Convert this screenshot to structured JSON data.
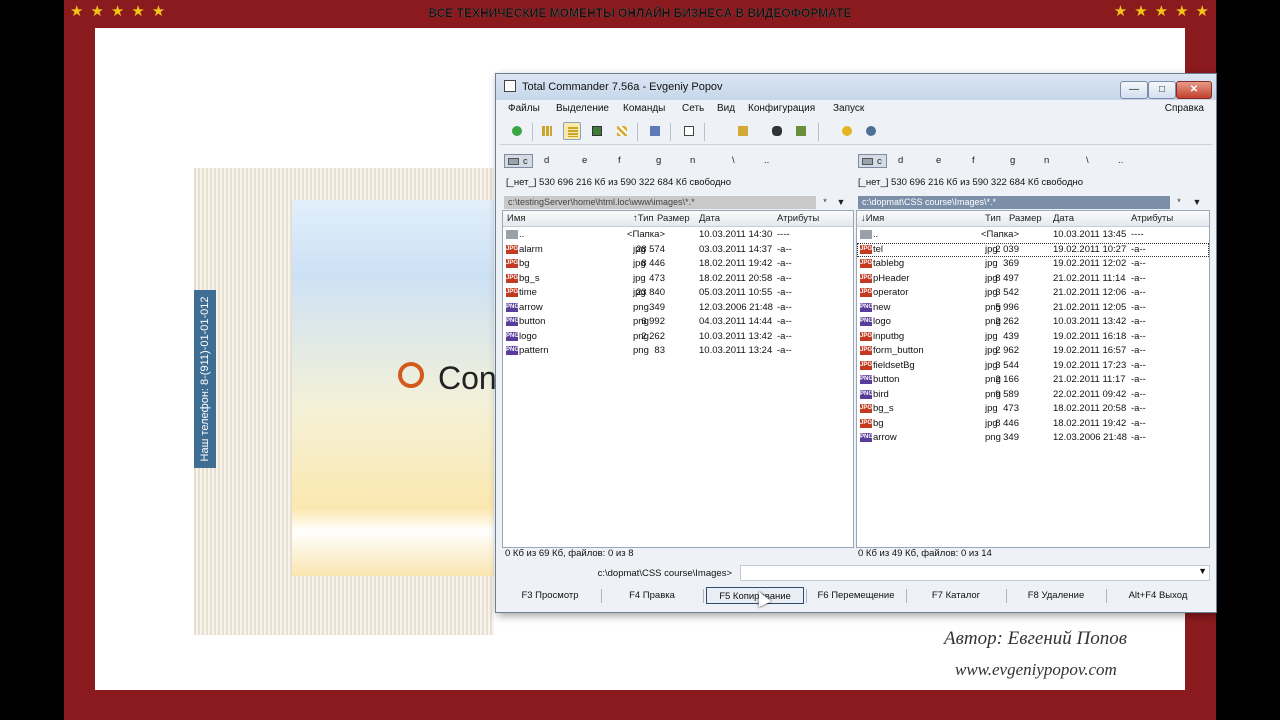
{
  "banner": "ВСЕ ТЕХНИЧЕСКИЕ МОМЕНТЫ ОНЛАЙН БИЗНЕСА В ВИДЕОФОРМАТЕ",
  "stars": "★★★★★",
  "site": {
    "phone": "Наш телефон: 8-(911)-01-01-012",
    "logo_text": "Con"
  },
  "credits": {
    "author": "Автор:  Евгений  Попов",
    "website": "www.evgeniypopov.com"
  },
  "colors": {
    "frame": "#8a1a1e",
    "star": "#f2c319",
    "tc_active_path": "#7c8fa8",
    "tc_window": "#eef1f5"
  },
  "tc": {
    "title": "Total Commander 7.56a - Evgeniy Popov",
    "window_buttons": {
      "minimize": "—",
      "maximize": "□",
      "close": "✕"
    },
    "menu": [
      "Файлы",
      "Выделение",
      "Команды",
      "Сеть",
      "Вид",
      "Конфигурация",
      "Запуск"
    ],
    "help": "Справка",
    "toolbar_icons": [
      "refresh-icon",
      "brief-view-icon",
      "full-view-icon",
      "thumbnails-icon",
      "tree-icon",
      "compare-icon",
      "quick-view-icon",
      "ftp-icon",
      "find-icon",
      "pack-icon",
      "info-icon",
      "network-icon"
    ],
    "drives": [
      "c",
      "d",
      "e",
      "f",
      "g",
      "n",
      "\\",
      ".."
    ],
    "left": {
      "free": "[_нет_]  530 696 216 Кб из 590 322 684 Кб свободно",
      "path": "c:\\testingServer\\home\\html.loc\\www\\images\\*.*",
      "columns": {
        "name": "Имя",
        "type": "Тип",
        "size": "Размер",
        "date": "Дата",
        "attr": "Атрибуты"
      },
      "files": [
        {
          "name": "..",
          "type": "",
          "size": "<Папка>",
          "date": "10.03.2011 14:30",
          "attr": "----",
          "icon": "up"
        },
        {
          "name": "alarm",
          "type": "jpg",
          "size": "28 574",
          "date": "03.03.2011 14:37",
          "attr": "-a--",
          "icon": "jpg"
        },
        {
          "name": "bg",
          "type": "jpg",
          "size": "8 446",
          "date": "18.02.2011 19:42",
          "attr": "-a--",
          "icon": "jpg"
        },
        {
          "name": "bg_s",
          "type": "jpg",
          "size": "473",
          "date": "18.02.2011 20:58",
          "attr": "-a--",
          "icon": "jpg"
        },
        {
          "name": "time",
          "type": "jpg",
          "size": "23 840",
          "date": "05.03.2011 10:55",
          "attr": "-a--",
          "icon": "jpg"
        },
        {
          "name": "arrow",
          "type": "png",
          "size": "349",
          "date": "12.03.2006 21:48",
          "attr": "-a--",
          "icon": "png"
        },
        {
          "name": "button",
          "type": "png",
          "size": "6 992",
          "date": "04.03.2011 14:44",
          "attr": "-a--",
          "icon": "png"
        },
        {
          "name": "logo",
          "type": "png",
          "size": "2 262",
          "date": "10.03.2011 13:42",
          "attr": "-a--",
          "icon": "png"
        },
        {
          "name": "pattern",
          "type": "png",
          "size": "83",
          "date": "10.03.2011 13:24",
          "attr": "-a--",
          "icon": "png"
        }
      ],
      "status": "0 Кб из 69 Кб, файлов: 0 из 8"
    },
    "right": {
      "free": "[_нет_]  530 696 216 Кб из 590 322 684 Кб свободно",
      "path": "c:\\dopmat\\CSS course\\Images\\*.*",
      "columns": {
        "name": "Имя",
        "type": "Тип",
        "size": "Размер",
        "date": "Дата",
        "attr": "Атрибуты"
      },
      "files": [
        {
          "name": "..",
          "type": "",
          "size": "<Папка>",
          "date": "10.03.2011 13:45",
          "attr": "----",
          "icon": "up"
        },
        {
          "name": "tel",
          "type": "jpg",
          "size": "2 039",
          "date": "19.02.2011 10:27",
          "attr": "-a--",
          "icon": "jpg"
        },
        {
          "name": "tablebg",
          "type": "jpg",
          "size": "369",
          "date": "19.02.2011 12:02",
          "attr": "-a--",
          "icon": "jpg"
        },
        {
          "name": "pHeader",
          "type": "jpg",
          "size": "8 497",
          "date": "21.02.2011 11:14",
          "attr": "-a--",
          "icon": "jpg"
        },
        {
          "name": "operator",
          "type": "jpg",
          "size": "3 542",
          "date": "21.02.2011 12:06",
          "attr": "-a--",
          "icon": "jpg"
        },
        {
          "name": "new",
          "type": "png",
          "size": "5 996",
          "date": "21.02.2011 12:05",
          "attr": "-a--",
          "icon": "png"
        },
        {
          "name": "logo",
          "type": "png",
          "size": "2 262",
          "date": "10.03.2011 13:42",
          "attr": "-a--",
          "icon": "png"
        },
        {
          "name": "inputbg",
          "type": "jpg",
          "size": "439",
          "date": "19.02.2011 16:18",
          "attr": "-a--",
          "icon": "jpg"
        },
        {
          "name": "form_button",
          "type": "jpg",
          "size": "2 962",
          "date": "19.02.2011 16:57",
          "attr": "-a--",
          "icon": "jpg"
        },
        {
          "name": "fieldsetBg",
          "type": "jpg",
          "size": "3 544",
          "date": "19.02.2011 17:23",
          "attr": "-a--",
          "icon": "jpg"
        },
        {
          "name": "button",
          "type": "png",
          "size": "2 166",
          "date": "21.02.2011 11:17",
          "attr": "-a--",
          "icon": "png"
        },
        {
          "name": "bird",
          "type": "png",
          "size": "9 589",
          "date": "22.02.2011 09:42",
          "attr": "-a--",
          "icon": "png"
        },
        {
          "name": "bg_s",
          "type": "jpg",
          "size": "473",
          "date": "18.02.2011 20:58",
          "attr": "-a--",
          "icon": "jpg"
        },
        {
          "name": "bg",
          "type": "jpg",
          "size": "8 446",
          "date": "18.02.2011 19:42",
          "attr": "-a--",
          "icon": "jpg"
        },
        {
          "name": "arrow",
          "type": "png",
          "size": "349",
          "date": "12.03.2006 21:48",
          "attr": "-a--",
          "icon": "png"
        }
      ],
      "status": "0 Кб из 49 Кб, файлов: 0 из 14"
    },
    "cmd_label": "c:\\dopmat\\CSS course\\Images>",
    "cmd_value": "",
    "fkeys": [
      "F3 Просмотр",
      "F4 Правка",
      "F5 Копирование",
      "F6 Перемещение",
      "F7 Каталог",
      "F8 Удаление",
      "Alt+F4 Выход"
    ]
  }
}
